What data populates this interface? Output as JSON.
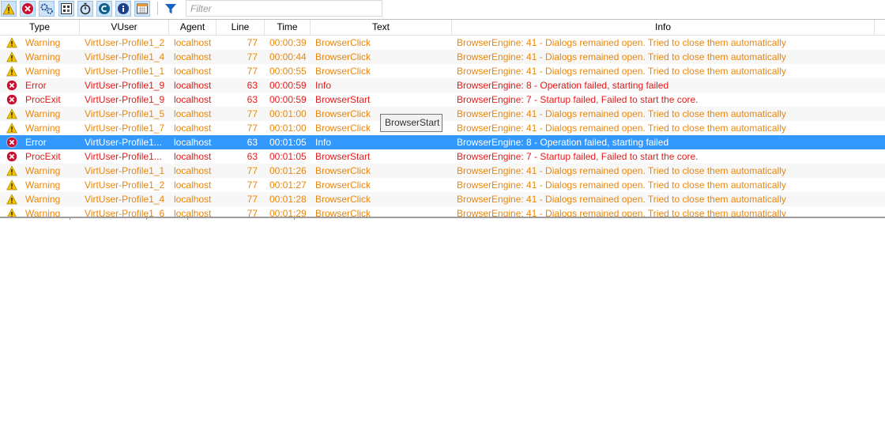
{
  "toolbar": {
    "buttons": [
      {
        "icon": "warning-filter-icon",
        "label": "Warnings"
      },
      {
        "icon": "error-filter-icon",
        "label": "Errors"
      },
      {
        "icon": "settings-filter-icon",
        "label": "Settings"
      },
      {
        "icon": "grid-filter-icon",
        "label": "Grid"
      },
      {
        "icon": "timer-filter-icon",
        "label": "Timer"
      },
      {
        "icon": "c-filter-icon",
        "label": "C"
      },
      {
        "icon": "info-filter-icon",
        "label": "Info"
      },
      {
        "icon": "calendar-filter-icon",
        "label": "Calendar"
      }
    ],
    "funnel_icon": "funnel-icon"
  },
  "filter": {
    "placeholder": "Filter",
    "value": ""
  },
  "columns": {
    "type": "Type",
    "vuser": "VUser",
    "agent": "Agent",
    "line": "Line",
    "time": "Time",
    "text": "Text",
    "info": "Info"
  },
  "rows": [
    {
      "kind": "warn",
      "type": "Warning",
      "vuser": "VirtUser-Profile1_2",
      "agent": "localhost",
      "line": "77",
      "time": "00:00:39",
      "text": "BrowserClick",
      "info": "BrowserEngine: 41 - Dialogs remained open. Tried to close them automatically"
    },
    {
      "kind": "warn",
      "type": "Warning",
      "vuser": "VirtUser-Profile1_4",
      "agent": "localhost",
      "line": "77",
      "time": "00:00:44",
      "text": "BrowserClick",
      "info": "BrowserEngine: 41 - Dialogs remained open. Tried to close them automatically"
    },
    {
      "kind": "warn",
      "type": "Warning",
      "vuser": "VirtUser-Profile1_1",
      "agent": "localhost",
      "line": "77",
      "time": "00:00:55",
      "text": "BrowserClick",
      "info": "BrowserEngine: 41 - Dialogs remained open. Tried to close them automatically"
    },
    {
      "kind": "err",
      "type": "Error",
      "vuser": "VirtUser-Profile1_9",
      "agent": "localhost",
      "line": "63",
      "time": "00:00:59",
      "text": "Info",
      "info": "BrowserEngine: 8 - Operation failed, starting failed"
    },
    {
      "kind": "err",
      "type": "ProcExit",
      "vuser": "VirtUser-Profile1_9",
      "agent": "localhost",
      "line": "63",
      "time": "00:00:59",
      "text": "BrowserStart",
      "info": "BrowserEngine: 7 - Startup failed, Failed to start the core."
    },
    {
      "kind": "warn",
      "type": "Warning",
      "vuser": "VirtUser-Profile1_5",
      "agent": "localhost",
      "line": "77",
      "time": "00:01:00",
      "text": "BrowserClick",
      "info": "BrowserEngine: 41 - Dialogs remained open. Tried to close them automatically"
    },
    {
      "kind": "warn",
      "type": "Warning",
      "vuser": "VirtUser-Profile1_7",
      "agent": "localhost",
      "line": "77",
      "time": "00:01:00",
      "text": "BrowserClick",
      "info": "BrowserEngine: 41 - Dialogs remained open. Tried to close them automatically"
    },
    {
      "kind": "err",
      "selected": true,
      "type": "Error",
      "vuser": "VirtUser-Profile1...",
      "agent": "localhost",
      "line": "63",
      "time": "00:01:05",
      "text": "Info",
      "info": "BrowserEngine: 8 - Operation failed, starting failed"
    },
    {
      "kind": "err",
      "type": "ProcExit",
      "vuser": "VirtUser-Profile1...",
      "agent": "localhost",
      "line": "63",
      "time": "00:01:05",
      "text": "BrowserStart",
      "info": "BrowserEngine: 7 - Startup failed, Failed to start the core."
    },
    {
      "kind": "warn",
      "type": "Warning",
      "vuser": "VirtUser-Profile1_1",
      "agent": "localhost",
      "line": "77",
      "time": "00:01:26",
      "text": "BrowserClick",
      "info": "BrowserEngine: 41 - Dialogs remained open. Tried to close them automatically"
    },
    {
      "kind": "warn",
      "type": "Warning",
      "vuser": "VirtUser-Profile1_2",
      "agent": "localhost",
      "line": "77",
      "time": "00:01:27",
      "text": "BrowserClick",
      "info": "BrowserEngine: 41 - Dialogs remained open. Tried to close them automatically"
    },
    {
      "kind": "warn",
      "type": "Warning",
      "vuser": "VirtUser-Profile1_4",
      "agent": "localhost",
      "line": "77",
      "time": "00:01:28",
      "text": "BrowserClick",
      "info": "BrowserEngine: 41 - Dialogs remained open. Tried to close them automatically"
    },
    {
      "kind": "warn",
      "type": "Warning",
      "vuser": "VirtUser-Profile1_6",
      "agent": "localhost",
      "line": "77",
      "time": "00:01:29",
      "text": "BrowserClick",
      "info": "BrowserEngine: 41 - Dialogs remained open. Tried to close them automatically"
    }
  ],
  "tooltip": {
    "text": "BrowserStart"
  },
  "colors": {
    "warning": "#e8870f",
    "error": "#e31b1b",
    "selection": "#3399ff"
  }
}
